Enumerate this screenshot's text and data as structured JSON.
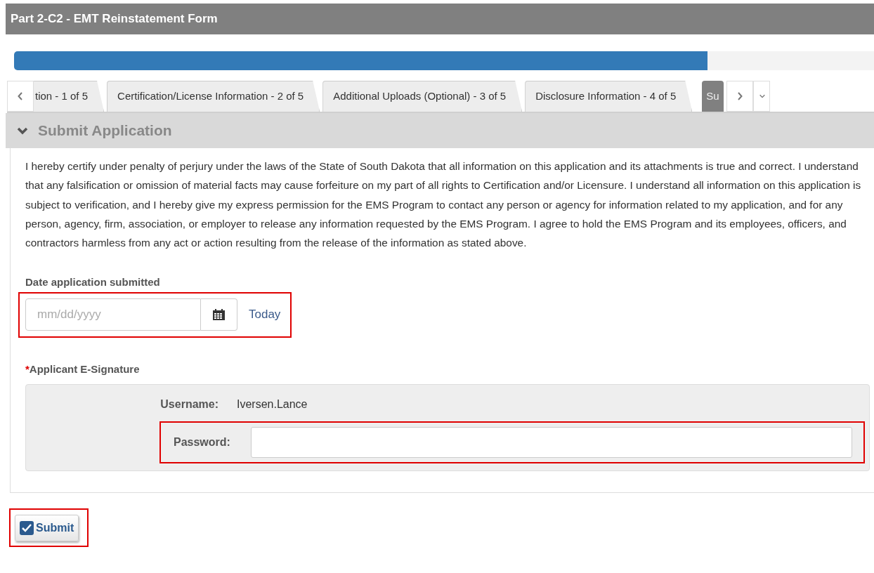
{
  "form_title": "Part 2-C2 - EMT Reinstatement Form",
  "progress": {
    "level": 0.806
  },
  "tabs": [
    {
      "label": "tion - 1 of 5",
      "selected": false
    },
    {
      "label": "Certification/License Information - 2 of 5",
      "selected": false
    },
    {
      "label": "Additional Uploads (Optional) - 3 of 5",
      "selected": false
    },
    {
      "label": "Disclosure Information - 4 of 5",
      "selected": false
    },
    {
      "label": "Su",
      "selected": true
    }
  ],
  "section": {
    "title": "Submit Application",
    "expanded": true
  },
  "certification_text": "I hereby certify under penalty of perjury under the laws of the State of South Dakota that all information on this application and its attachments is true and correct.  I understand that any falsification or omission of material facts may cause forfeiture on my part of all rights to Certification and/or Licensure. I understand all information on this application is subject to verification, and I hereby give my express permission for the EMS Program to contact any person or agency for information related to my application, and for any person, agency, firm, association, or employer to release any information requested by the EMS Program. I agree to hold the EMS Program and its employees, officers, and contractors harmless from any act or action resulting from the release of the information as stated above.",
  "date_field": {
    "label": "Date application submitted",
    "placeholder": "mm/dd/yyyy",
    "today_link": "Today",
    "highlighted": true
  },
  "signature": {
    "required_mark": "*",
    "label": "Applicant E-Signature",
    "username_label": "Username:",
    "username": "Iversen.Lance",
    "password_label": "Password:",
    "password_highlighted": true
  },
  "submit": {
    "label": "Submit",
    "highlighted": true
  }
}
